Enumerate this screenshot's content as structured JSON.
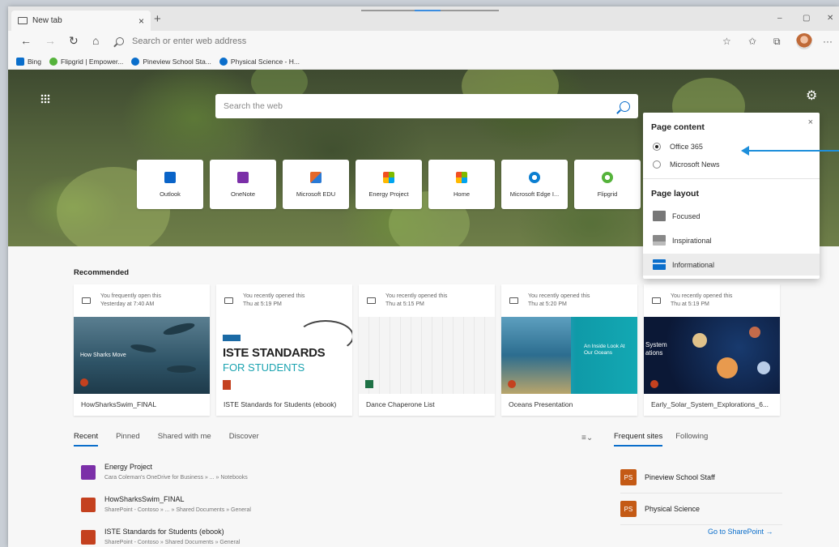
{
  "browser": {
    "tab_title": "New tab",
    "tab_close": "×",
    "new_tab": "+",
    "address_placeholder": "Search or enter web address",
    "window_controls": {
      "minimize": "–",
      "maximize": "▢",
      "close": "✕"
    }
  },
  "favorites": [
    {
      "label": "Bing",
      "color": "#0a6ecb"
    },
    {
      "label": "Flipgrid | Empower...",
      "color": "#55b33b"
    },
    {
      "label": "Pineview School Sta...",
      "color": "#0a6ecb"
    },
    {
      "label": "Physical Science - H...",
      "color": "#0a6ecb"
    }
  ],
  "hero": {
    "search_placeholder": "Search the web",
    "tiles": [
      {
        "label": "Outlook",
        "icon": "outlook-icon",
        "color": "#0a64c8"
      },
      {
        "label": "OneNote",
        "icon": "onenote-icon",
        "color": "#7b2fa8"
      },
      {
        "label": "Microsoft EDU",
        "icon": "microsoft-edu-icon",
        "color": "#e5682a"
      },
      {
        "label": "Energy Project",
        "icon": "windows-logo-icon",
        "color": "#f25022"
      },
      {
        "label": "Home",
        "icon": "windows-logo-icon",
        "color": "#f25022"
      },
      {
        "label": "Microsoft Edge I...",
        "icon": "edge-icon",
        "color": "#0c7fd1"
      },
      {
        "label": "Flipgrid",
        "icon": "flipgrid-icon",
        "color": "#55b33b"
      }
    ]
  },
  "panel": {
    "content_heading": "Page content",
    "content_options": [
      {
        "label": "Office 365",
        "selected": true
      },
      {
        "label": "Microsoft News",
        "selected": false
      }
    ],
    "layout_heading": "Page layout",
    "layout_options": [
      {
        "label": "Focused",
        "selected": false
      },
      {
        "label": "Inspirational",
        "selected": false
      },
      {
        "label": "Informational",
        "selected": true
      }
    ],
    "close": "×"
  },
  "recommended": {
    "title": "Recommended",
    "cards": [
      {
        "reason": "You frequently open this",
        "when": "Yesterday at 7:40 AM",
        "name": "HowSharksSwim_FINAL",
        "thumb_text": "How Sharks Move"
      },
      {
        "reason": "You recently opened this",
        "when": "Thu at 5:19 PM",
        "name": "ISTE Standards for Students (ebook)",
        "thumb_text": "ISTE STANDARDS",
        "thumb_sub": "FOR STUDENTS"
      },
      {
        "reason": "You recently opened this",
        "when": "Thu at 5:15 PM",
        "name": "Dance Chaperone List"
      },
      {
        "reason": "You recently opened this",
        "when": "Thu at 5:20 PM",
        "name": "Oceans Presentation",
        "thumb_text": "An Inside Look At Our Oceans"
      },
      {
        "reason": "You recently opened this",
        "when": "Thu at 5:19 PM",
        "name": "Early_Solar_System_Explorations_6...",
        "thumb_text": "System ations"
      }
    ]
  },
  "file_tabs": [
    "Recent",
    "Pinned",
    "Shared with me",
    "Discover"
  ],
  "site_tabs": [
    "Frequent sites",
    "Following"
  ],
  "files": [
    {
      "name": "Energy Project",
      "path": "Cara Coleman's OneDrive for Business » ... » Notebooks",
      "color": "#7b2fa8",
      "letter": "N"
    },
    {
      "name": "HowSharksSwim_FINAL",
      "path": "SharePoint - Contoso » ... » Shared Documents » General",
      "color": "#c4411f",
      "letter": "P"
    },
    {
      "name": "ISTE Standards for Students (ebook)",
      "path": "SharePoint - Contoso » Shared Documents » General",
      "color": "#c4411f",
      "letter": "PDF"
    }
  ],
  "sites": [
    {
      "badge": "PS",
      "label": "Pineview School Staff"
    },
    {
      "badge": "PS",
      "label": "Physical Science"
    }
  ],
  "goto_sharepoint": "Go to SharePoint →"
}
